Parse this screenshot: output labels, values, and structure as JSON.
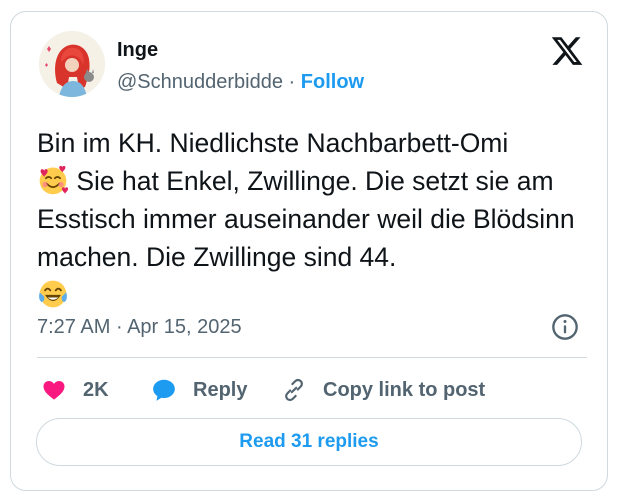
{
  "author": {
    "name": "Inge",
    "handle": "@Schnudderbidde",
    "separator": "·",
    "follow_label": "Follow"
  },
  "tweet": {
    "text_part1": "Bin im KH. Niedlichste Nachbarbett-Omi",
    "text_part2": " Sie hat Enkel, Zwillinge. Die setzt sie am Esstisch immer auseinander weil die Blödsinn machen. Die Zwillinge sind 44.",
    "emoji_1": "smiling-face-with-hearts",
    "emoji_2": "face-with-tears-of-joy"
  },
  "meta": {
    "time": "7:27 AM",
    "separator": "·",
    "date": "Apr 15, 2025"
  },
  "actions": {
    "like_count": "2K",
    "reply_label": "Reply",
    "copy_label": "Copy link to post"
  },
  "footer": {
    "read_replies_label": "Read 31 replies"
  },
  "colors": {
    "accent": "#1d9bf0",
    "like": "#f91880",
    "secondary_text": "#536471",
    "border": "#cfd9de"
  }
}
